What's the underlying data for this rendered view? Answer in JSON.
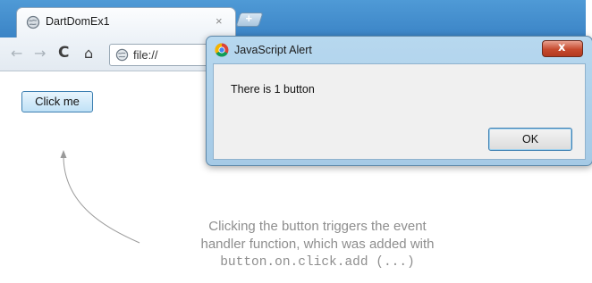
{
  "browser": {
    "tab": {
      "title": "DartDomEx1",
      "close_glyph": "×",
      "favicon": "globe-icon"
    },
    "new_tab_glyph": "+",
    "toolbar": {
      "back_glyph": "←",
      "forward_glyph": "→",
      "reload_glyph": "C",
      "home_glyph": "⌂",
      "address_text": "file://"
    },
    "page": {
      "button_label": "Click me"
    }
  },
  "alert": {
    "title": "JavaScript Alert",
    "close_glyph": "x",
    "message": "There is 1 button",
    "ok_label": "OK"
  },
  "annotation": {
    "line1": "Clicking the button triggers the event",
    "line2": "handler function, which was added with",
    "code": "button.on.click.add (...)"
  },
  "colors": {
    "frame_blue": "#4f9ad6",
    "button_blue": "#bfe1f6",
    "caption_gray": "#8e8e8e",
    "alert_close_red": "#c64a2e"
  }
}
